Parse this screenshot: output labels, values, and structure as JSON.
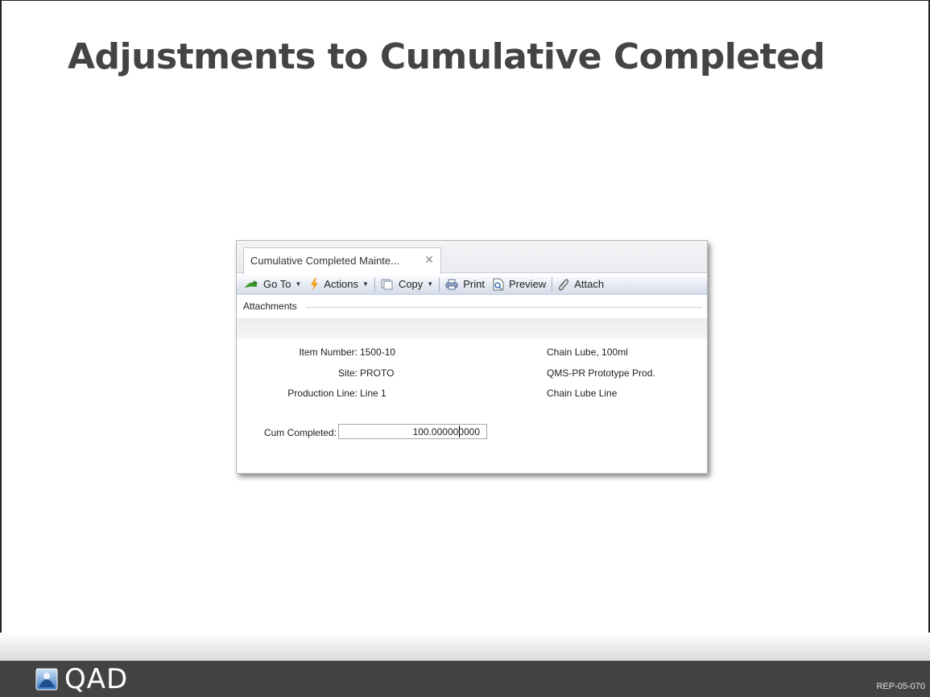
{
  "slide": {
    "title": "Adjustments to Cumulative Completed"
  },
  "window": {
    "tab_label": "Cumulative Completed Mainte...",
    "tab_close": "✕",
    "toolbar": {
      "goto": "Go To",
      "actions": "Actions",
      "copy": "Copy",
      "print": "Print",
      "preview": "Preview",
      "attach": "Attach"
    },
    "section_label": "Attachments",
    "fields": {
      "item_number_label": "Item Number:",
      "item_number_value": "1500-10",
      "item_desc": "Chain Lube, 100ml",
      "site_label": "Site:",
      "site_value": "PROTO",
      "site_desc": "QMS-PR Prototype Prod.",
      "prod_line_label": "Production Line:",
      "prod_line_value": "Line 1",
      "prod_line_desc": "Chain Lube Line",
      "cum_completed_label": "Cum Completed:",
      "cum_completed_value": "100.000000000"
    }
  },
  "footer": {
    "logo_text": "QAD",
    "slide_code": "REP-05-070"
  },
  "colors": {
    "title": "#444444",
    "footer_bg": "#434343",
    "toolbar_bg": "#dde3ee"
  }
}
